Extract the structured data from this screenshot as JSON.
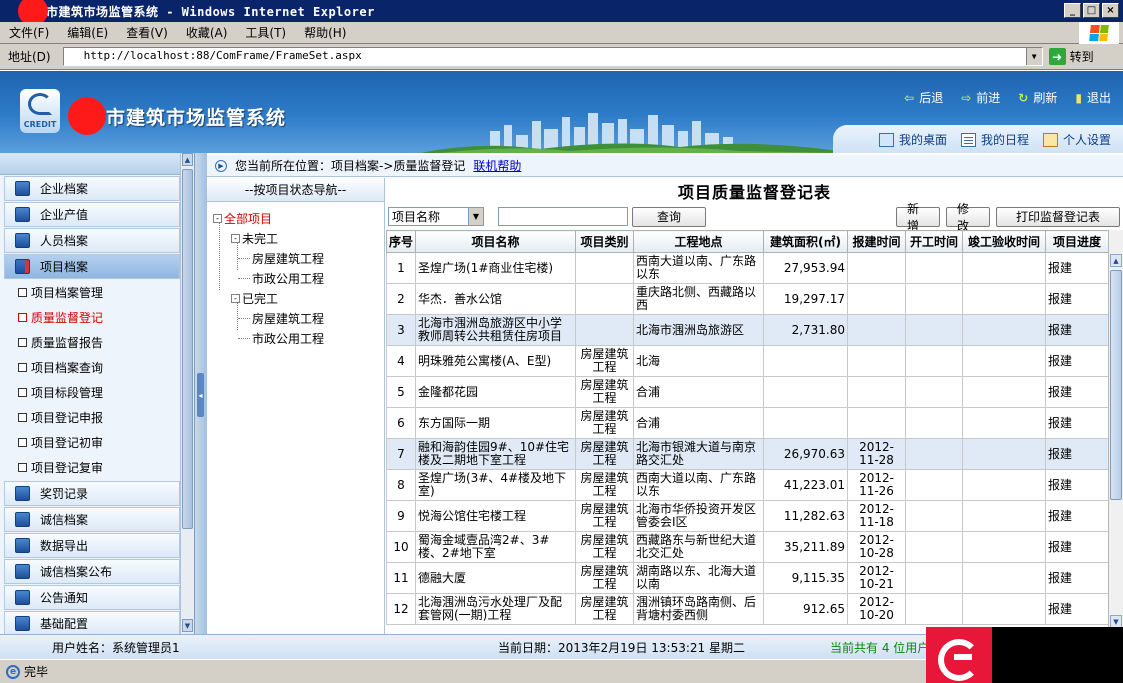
{
  "window": {
    "title": "市建筑市场监管系统 - Windows Internet Explorer",
    "btn_min": "_",
    "btn_max": "□",
    "btn_close": "×"
  },
  "menu": {
    "items": [
      "文件(F)",
      "编辑(E)",
      "查看(V)",
      "收藏(A)",
      "工具(T)",
      "帮助(H)"
    ]
  },
  "address": {
    "label": "地址(D)",
    "url": "http://localhost:88/ComFrame/FrameSet.aspx",
    "go_label": "转到"
  },
  "header": {
    "logo_text": "CREDIT",
    "app_title": "市建筑市场监管系统",
    "nav": [
      {
        "label": "后退",
        "icon": "back-arrow-icon"
      },
      {
        "label": "前进",
        "icon": "forward-arrow-icon"
      },
      {
        "label": "刷新",
        "icon": "refresh-icon"
      },
      {
        "label": "退出",
        "icon": "exit-icon"
      }
    ],
    "quick": [
      {
        "label": "我的桌面",
        "icon": "desktop-icon"
      },
      {
        "label": "我的日程",
        "icon": "calendar-icon"
      },
      {
        "label": "个人设置",
        "icon": "settings-icon"
      }
    ]
  },
  "sidebar": {
    "items": [
      {
        "label": "企业档案",
        "type": "category"
      },
      {
        "label": "企业产值",
        "type": "category"
      },
      {
        "label": "人员档案",
        "type": "category"
      },
      {
        "label": "项目档案",
        "type": "category",
        "active": true
      },
      {
        "label": "项目档案管理",
        "type": "sub"
      },
      {
        "label": "质量监督登记",
        "type": "sub",
        "active": true
      },
      {
        "label": "质量监督报告",
        "type": "sub"
      },
      {
        "label": "项目档案查询",
        "type": "sub"
      },
      {
        "label": "项目标段管理",
        "type": "sub"
      },
      {
        "label": "项目登记申报",
        "type": "sub"
      },
      {
        "label": "项目登记初审",
        "type": "sub"
      },
      {
        "label": "项目登记复审",
        "type": "sub"
      },
      {
        "label": "奖罚记录",
        "type": "category"
      },
      {
        "label": "诚信档案",
        "type": "category"
      },
      {
        "label": "数据导出",
        "type": "category"
      },
      {
        "label": "诚信档案公布",
        "type": "category"
      },
      {
        "label": "公告通知",
        "type": "category"
      },
      {
        "label": "基础配置",
        "type": "category"
      }
    ]
  },
  "breadcrumb": {
    "text": "您当前所在位置：项目档案->质量监督登记",
    "help": "联机帮助"
  },
  "tree": {
    "header": "--按项目状态导航--",
    "root": "全部项目",
    "unfinished": "未完工",
    "finished": "已完工",
    "house": "房屋建筑工程",
    "municipal": "市政公用工程",
    "expander": "-"
  },
  "main": {
    "title": "项目质量监督登记表",
    "search_field": "项目名称",
    "search_value": "",
    "btn_search": "查询",
    "btn_new": "新 增",
    "btn_edit": "修 改",
    "btn_print": "打印监督登记表",
    "columns": [
      "序号",
      "项目名称",
      "项目类别",
      "工程地点",
      "建筑面积(㎡)",
      "报建时间",
      "开工时间",
      "竣工验收时间",
      "项目进度"
    ],
    "rows": [
      {
        "no": "1",
        "name": "圣煌广场(1#商业住宅楼)",
        "type": "",
        "loc": "西南大道以南、广东路以东",
        "area": "27,953.94",
        "reg": "",
        "start": "",
        "done": "",
        "prog": "报建"
      },
      {
        "no": "2",
        "name": "华杰．善水公馆",
        "type": "",
        "loc": "重庆路北侧、西藏路以西",
        "area": "19,297.17",
        "reg": "",
        "start": "",
        "done": "",
        "prog": "报建"
      },
      {
        "no": "3",
        "name": "北海市涠洲岛旅游区中小学教师周转公共租赁住房项目",
        "type": "",
        "loc": "北海市涠洲岛旅游区",
        "area": "2,731.80",
        "reg": "",
        "start": "",
        "done": "",
        "prog": "报建",
        "hl": true
      },
      {
        "no": "4",
        "name": "明珠雅苑公寓楼(A、E型)",
        "type": "房屋建筑工程",
        "loc": "北海",
        "area": "",
        "reg": "",
        "start": "",
        "done": "",
        "prog": "报建"
      },
      {
        "no": "5",
        "name": "金隆都花园",
        "type": "房屋建筑工程",
        "loc": "合浦",
        "area": "",
        "reg": "",
        "start": "",
        "done": "",
        "prog": "报建"
      },
      {
        "no": "6",
        "name": "东方国际一期",
        "type": "房屋建筑工程",
        "loc": "合浦",
        "area": "",
        "reg": "",
        "start": "",
        "done": "",
        "prog": "报建"
      },
      {
        "no": "7",
        "name": "融和海韵佳园9#、10#住宅楼及二期地下室工程",
        "type": "房屋建筑工程",
        "loc": "北海市银滩大道与南京路交汇处",
        "area": "26,970.63",
        "reg": "2012-11-28",
        "start": "",
        "done": "",
        "prog": "报建",
        "hl": true
      },
      {
        "no": "8",
        "name": "圣煌广场(3#、4#楼及地下室)",
        "type": "房屋建筑工程",
        "loc": "西南大道以南、广东路以东",
        "area": "41,223.01",
        "reg": "2012-11-26",
        "start": "",
        "done": "",
        "prog": "报建"
      },
      {
        "no": "9",
        "name": "悦海公馆住宅楼工程",
        "type": "房屋建筑工程",
        "loc": "北海市华侨投资开发区管委会Ⅰ区",
        "area": "11,282.63",
        "reg": "2012-11-18",
        "start": "",
        "done": "",
        "prog": "报建"
      },
      {
        "no": "10",
        "name": "蜀海金域壹品湾2#、3#楼、2#地下室",
        "type": "房屋建筑工程",
        "loc": "西藏路东与新世纪大道北交汇处",
        "area": "35,211.89",
        "reg": "2012-10-28",
        "start": "",
        "done": "",
        "prog": "报建"
      },
      {
        "no": "11",
        "name": "德融大厦",
        "type": "房屋建筑工程",
        "loc": "湖南路以东、北海大道以南",
        "area": "9,115.35",
        "reg": "2012-10-21",
        "start": "",
        "done": "",
        "prog": "报建"
      },
      {
        "no": "12",
        "name": "北海涠洲岛污水处理厂及配套管网(一期)工程",
        "type": "房屋建筑工程",
        "loc": "涠洲镇环岛路南侧、后背塘村委西侧",
        "area": "912.65",
        "reg": "2012-10-20",
        "start": "",
        "done": "",
        "prog": "报建"
      }
    ]
  },
  "status": {
    "user": "用户姓名：系统管理员1",
    "date": "当前日期：2013年2月19日  13:53:21  星期二",
    "online": "当前共有 4 位用户",
    "ie_status": "完毕"
  }
}
